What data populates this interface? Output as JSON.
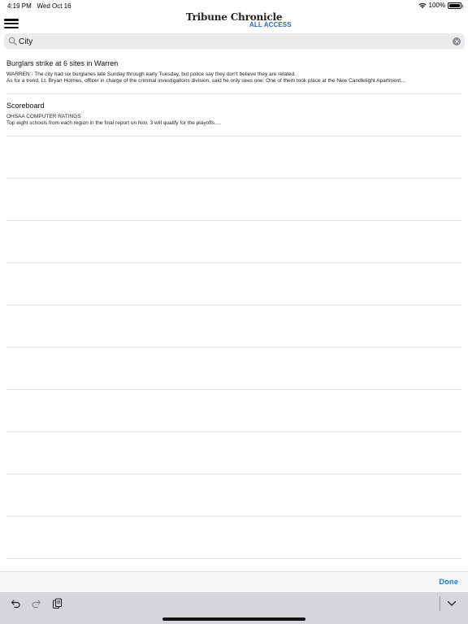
{
  "status_bar": {
    "time": "4:19 PM",
    "date": "Wed Oct 16",
    "battery_text": "100%",
    "battery_level": 1.0,
    "wifi_icon": "wifi-icon"
  },
  "header": {
    "logo_main": "Tribune Chronicle",
    "logo_sub": "ALL ACCESS",
    "logo_sub_color": "#2a66b8",
    "menu_icon": "hamburger-menu-icon"
  },
  "search": {
    "value": "City",
    "placeholder": "",
    "search_icon": "magnifier-icon",
    "clear_icon": "clear-icon"
  },
  "results": [
    {
      "title": "Burglars strike at 6 sites in Warren",
      "line1": "WARREN - The city had six burglaries late Sunday through early Tuesday, but police say they don't believe they are related.",
      "line2": "As for a trend, Lt. Bryan Holmes, officer in charge of the criminal investigations division, said he only sees one: One of them took place at the New Candlelight Apartment…"
    },
    {
      "title": "Scoreboard",
      "line1": "OHSAA COMPUTER RATINGS",
      "line2": "Top eight schools from each region in the final report on Nov. 3 will qualify for the playoffs.…"
    }
  ],
  "keyboard_toolbar": {
    "done_label": "Done",
    "accent_color": "#1a7fd7",
    "undo_icon": "undo-icon",
    "redo_icon": "redo-icon",
    "paste_icon": "clipboard-icon",
    "dismiss_icon": "chevron-down-icon"
  }
}
